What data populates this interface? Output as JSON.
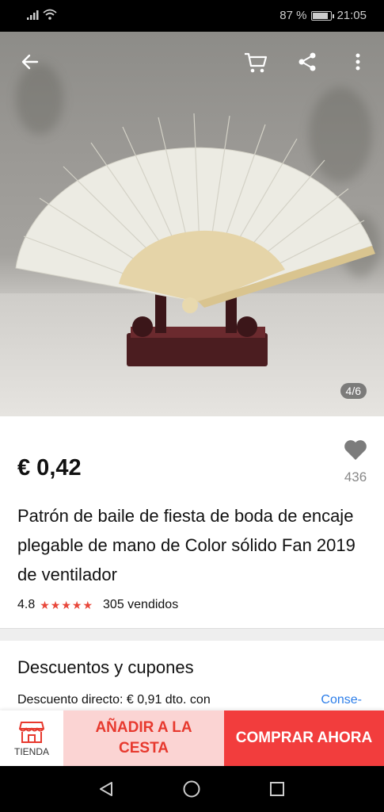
{
  "status_bar": {
    "battery": "87 %",
    "battery_level": 0.87,
    "time": "21:05"
  },
  "gallery": {
    "counter": "4/6",
    "icons": [
      "back-arrow-icon",
      "cart-icon",
      "share-icon",
      "more-icon"
    ]
  },
  "product": {
    "price": "€ 0,42",
    "wishlist_count": "436",
    "title": "Patrón de baile de fiesta de boda de encaje plegable de mano de Color sólido Fan 2019 de ventilador",
    "rating": "4.8",
    "stars": "★★★★★",
    "sold": "305 vendidos"
  },
  "discounts": {
    "title": "Descuentos y cupones",
    "line": "Descuento directo: € 0,91 dto. con",
    "link": "Conse-"
  },
  "actions": {
    "store_label": "TIENDA",
    "add_to_cart": "AÑADIR A LA CESTA",
    "buy_now": "COMPRAR AHORA"
  },
  "colors": {
    "accent_red": "#f23d3d",
    "add_cart_bg": "#fbd4d3",
    "link_blue": "#2b7de9"
  }
}
